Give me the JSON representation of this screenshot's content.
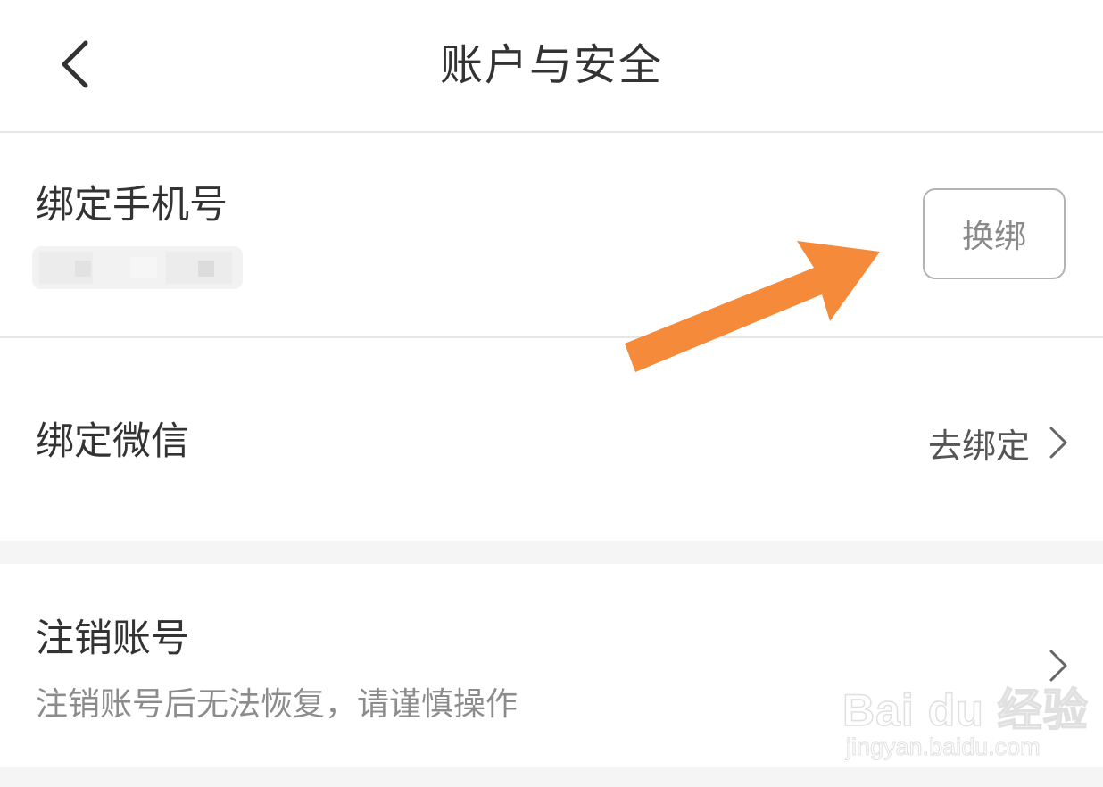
{
  "header": {
    "title": "账户与安全",
    "back_icon": "chevron-left-icon"
  },
  "phone_section": {
    "title": "绑定手机号",
    "rebind_label": "换绑"
  },
  "wechat_section": {
    "title": "绑定微信",
    "action_label": "去绑定",
    "action_icon": "chevron-right-icon"
  },
  "cancel_section": {
    "title": "注销账号",
    "subtitle": "注销账号后无法恢复，请谨慎操作",
    "action_icon": "chevron-right-icon"
  },
  "annotation": {
    "arrow_color": "#f58b3a",
    "icon": "orange-arrow-icon"
  },
  "watermark": {
    "logo_text": "Bai du 经验",
    "url": "jingyan.baidu.com"
  },
  "colors": {
    "text_primary": "#333333",
    "text_secondary": "#8c8c8c",
    "divider": "#e6e6e6",
    "section_gap": "#f5f5f5",
    "button_border": "#b3b3b3"
  }
}
